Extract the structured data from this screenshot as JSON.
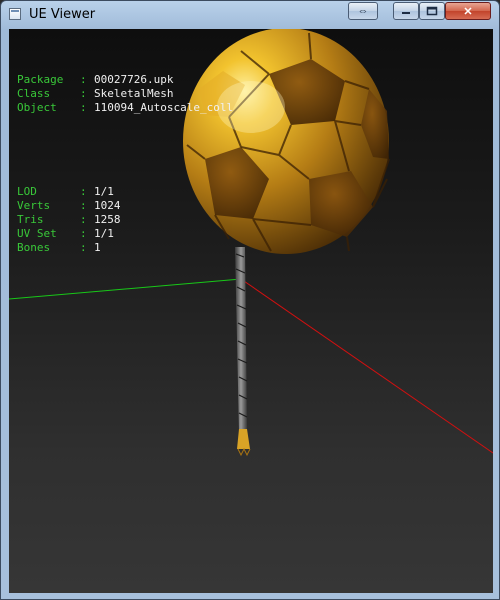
{
  "window": {
    "title": "UE Viewer",
    "buttons": {
      "switch_icon": "⇔",
      "minimize_icon": "minimize-icon",
      "maximize_icon": "maximize-icon",
      "close_icon": "✕"
    }
  },
  "info_top": [
    {
      "label": "Package",
      "sep": ":",
      "value": "00027726.upk"
    },
    {
      "label": "Class",
      "sep": ":",
      "value": "SkeletalMesh"
    },
    {
      "label": "Object",
      "sep": ":",
      "value": "110094_Autoscale_coll"
    }
  ],
  "info_bottom": [
    {
      "label": "LOD",
      "sep": ":",
      "value": "1/1"
    },
    {
      "label": "Verts",
      "sep": ":",
      "value": "1024"
    },
    {
      "label": "Tris",
      "sep": ":",
      "value": "1258"
    },
    {
      "label": "UV Set",
      "sep": ":",
      "value": "1/1"
    },
    {
      "label": "Bones",
      "sep": ":",
      "value": "1"
    }
  ],
  "colors": {
    "label_green": "#39c839",
    "axis_x": "#d01010",
    "axis_y": "#18c818",
    "axis_z": "#2020d0",
    "ball_gold": "#c8921a"
  }
}
